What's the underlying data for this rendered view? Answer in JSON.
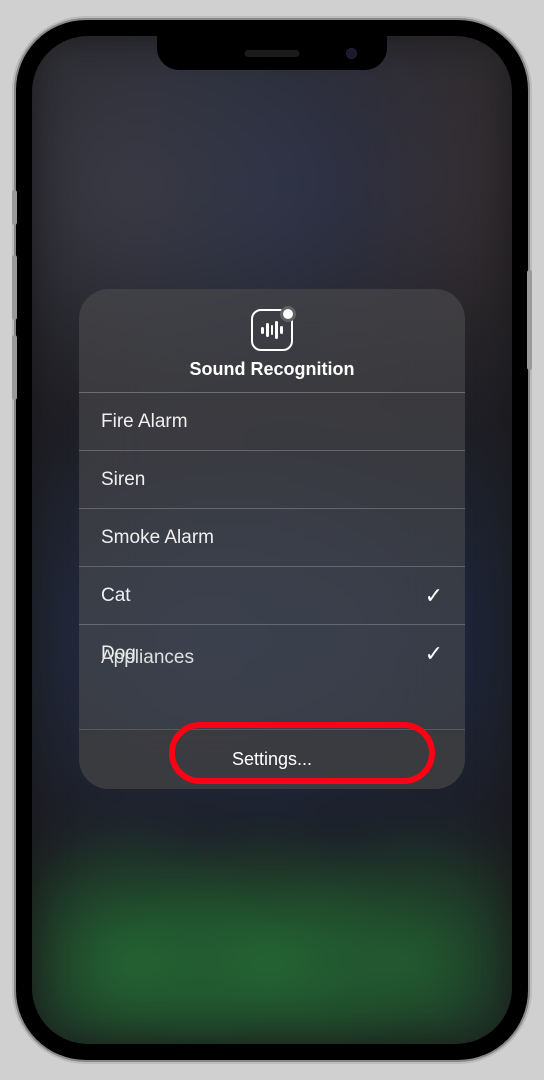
{
  "header": {
    "title": "Sound Recognition"
  },
  "sounds": [
    {
      "label": "Fire Alarm",
      "checked": false
    },
    {
      "label": "Siren",
      "checked": false
    },
    {
      "label": "Smoke Alarm",
      "checked": false
    },
    {
      "label": "Cat",
      "checked": true
    },
    {
      "label": "Dog",
      "checked": true
    },
    {
      "label": "Appliances",
      "checked": false
    }
  ],
  "footer": {
    "settings_label": "Settings..."
  }
}
